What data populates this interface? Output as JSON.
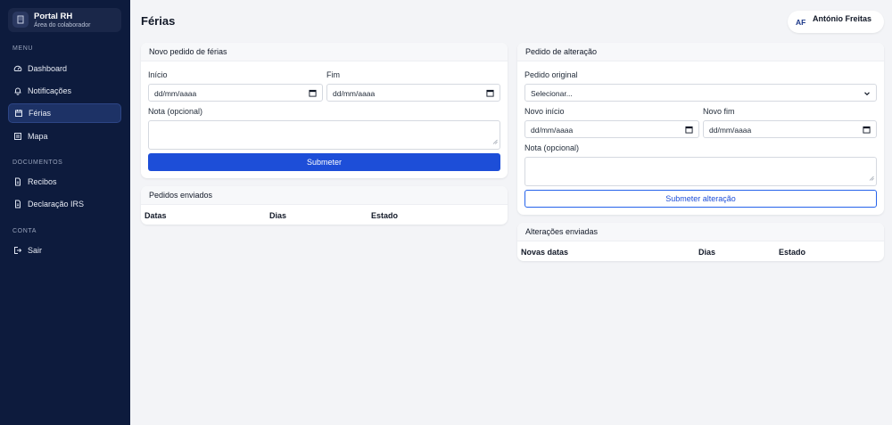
{
  "brand": {
    "title": "Portal RH",
    "subtitle": "Área do colaborador"
  },
  "sidebar": {
    "sections": [
      {
        "label": "MENU",
        "items": [
          {
            "label": "Dashboard",
            "icon": "gauge-icon"
          },
          {
            "label": "Notificações",
            "icon": "bell-icon"
          },
          {
            "label": "Férias",
            "icon": "calendar-icon",
            "active": true
          },
          {
            "label": "Mapa",
            "icon": "map-icon"
          }
        ]
      },
      {
        "label": "DOCUMENTOS",
        "items": [
          {
            "label": "Recibos",
            "icon": "document-icon"
          },
          {
            "label": "Declaração IRS",
            "icon": "document-icon"
          }
        ]
      },
      {
        "label": "CONTA",
        "items": [
          {
            "label": "Sair",
            "icon": "logout-icon"
          }
        ]
      }
    ]
  },
  "header": {
    "title": "Férias",
    "user_initials": "AF",
    "user_name": "António Freitas"
  },
  "new_request": {
    "title": "Novo pedido de férias",
    "start_label": "Início",
    "start_placeholder": "dd/mm/aaaa",
    "end_label": "Fim",
    "end_placeholder": "dd/mm/aaaa",
    "note_label": "Nota (opcional)",
    "submit_label": "Submeter"
  },
  "sent_requests": {
    "title": "Pedidos enviados",
    "columns": [
      "Datas",
      "Dias",
      "Estado"
    ]
  },
  "change_request": {
    "title": "Pedido de alteração",
    "original_label": "Pedido original",
    "original_value": "Selecionar...",
    "new_start_label": "Novo início",
    "new_start_placeholder": "dd/mm/aaaa",
    "new_end_label": "Novo fim",
    "new_end_placeholder": "dd/mm/aaaa",
    "note_label": "Nota (opcional)",
    "submit_label": "Submeter alteração"
  },
  "sent_changes": {
    "title": "Alterações enviadas",
    "columns": [
      "Novas datas",
      "Dias",
      "Estado"
    ]
  },
  "colors": {
    "sidebar_bg": "#0d1b3d",
    "active_item": "#1d3266",
    "primary": "#1d4ed8",
    "page_bg": "#f3f4f7"
  }
}
